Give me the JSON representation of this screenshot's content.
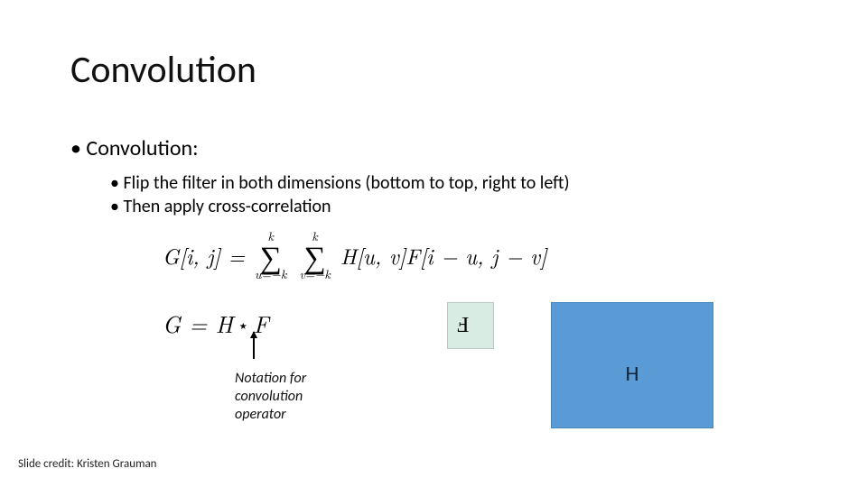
{
  "title": "Convolution",
  "b1": "Convolution:",
  "subs": [
    "Flip the filter in both dimensions (bottom to top, right to left)",
    "Then apply cross-correlation"
  ],
  "eq1": {
    "lhs": "G[i, j] = ",
    "sum_top": "k",
    "sum_bot1": "u=−k",
    "sum_bot2": "v=−k",
    "rhs": " H[u, v]F[i − u, j − v]"
  },
  "eq2": {
    "lhs": "G = H",
    "star": "⋆",
    "rhs": "F"
  },
  "annotation": {
    "l1": "Notation for",
    "l2": "convolution",
    "l3": "operator"
  },
  "small_shape_letter": "F",
  "big_shape_letter": "H",
  "credit": "Slide credit: Kristen Grauman"
}
